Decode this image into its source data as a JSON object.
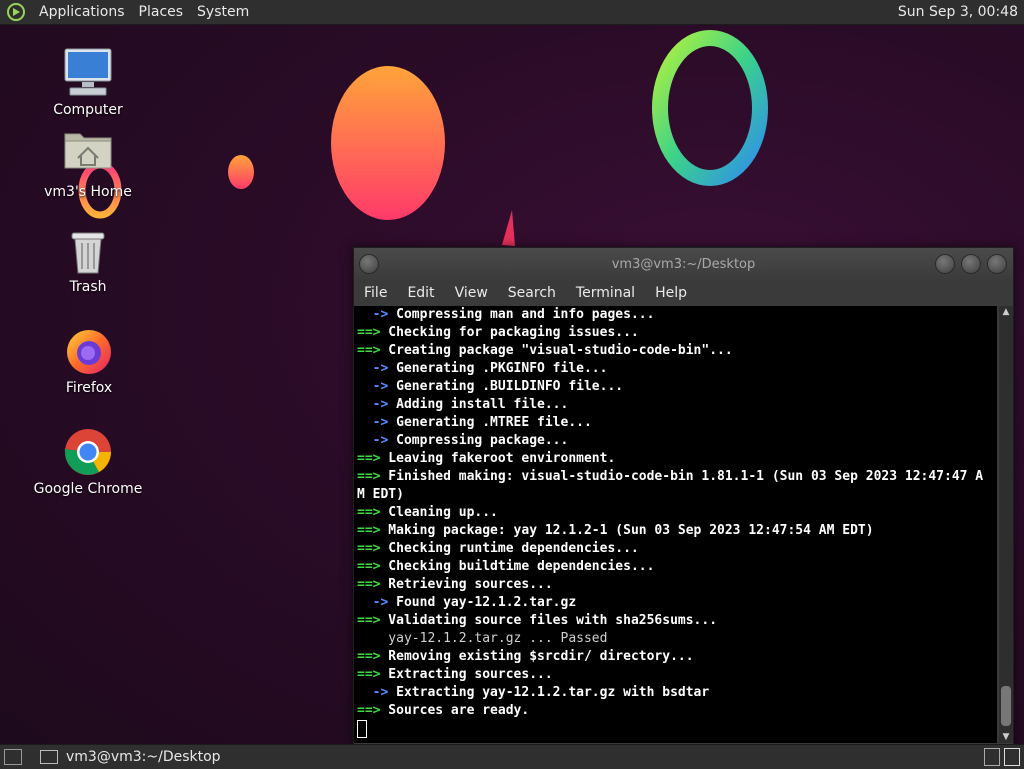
{
  "top_panel": {
    "menus": [
      "Applications",
      "Places",
      "System"
    ],
    "clock": "Sun Sep  3, 00:48"
  },
  "desktop": {
    "icons": [
      {
        "label": "Computer",
        "icon": "computer-icon"
      },
      {
        "label": "vm3's Home",
        "icon": "home-folder-icon"
      },
      {
        "label": "Trash",
        "icon": "trash-icon"
      },
      {
        "label": "Firefox",
        "icon": "firefox-icon"
      },
      {
        "label": "Google Chrome",
        "icon": "chrome-icon"
      }
    ]
  },
  "terminal": {
    "title": "vm3@vm3:~/Desktop",
    "menu": [
      "File",
      "Edit",
      "View",
      "Search",
      "Terminal",
      "Help"
    ],
    "lines": [
      {
        "p": "  ->",
        "t": " Compressing man and info pages..."
      },
      {
        "p": "==>",
        "t": " Checking for packaging issues..."
      },
      {
        "p": "==>",
        "t": " Creating package \"visual-studio-code-bin\"..."
      },
      {
        "p": "  ->",
        "t": " Generating .PKGINFO file..."
      },
      {
        "p": "  ->",
        "t": " Generating .BUILDINFO file..."
      },
      {
        "p": "  ->",
        "t": " Adding install file..."
      },
      {
        "p": "  ->",
        "t": " Generating .MTREE file..."
      },
      {
        "p": "  ->",
        "t": " Compressing package..."
      },
      {
        "p": "==>",
        "t": " Leaving fakeroot environment."
      },
      {
        "p": "==>",
        "t": " Finished making: visual-studio-code-bin 1.81.1-1 (Sun 03 Sep 2023 12:47:47 A"
      },
      {
        "p": "",
        "t": "M EDT)"
      },
      {
        "p": "==>",
        "t": " Cleaning up..."
      },
      {
        "p": "==>",
        "t": " Making package: yay 12.1.2-1 (Sun 03 Sep 2023 12:47:54 AM EDT)"
      },
      {
        "p": "==>",
        "t": " Checking runtime dependencies..."
      },
      {
        "p": "==>",
        "t": " Checking buildtime dependencies..."
      },
      {
        "p": "==>",
        "t": " Retrieving sources..."
      },
      {
        "p": "  ->",
        "t": " Found yay-12.1.2.tar.gz"
      },
      {
        "p": "==>",
        "t": " Validating source files with sha256sums..."
      },
      {
        "p": "",
        "t": "    yay-12.1.2.tar.gz ... Passed",
        "normal": true
      },
      {
        "p": "==>",
        "t": " Removing existing $srcdir/ directory..."
      },
      {
        "p": "==>",
        "t": " Extracting sources..."
      },
      {
        "p": "  ->",
        "t": " Extracting yay-12.1.2.tar.gz with bsdtar"
      },
      {
        "p": "==>",
        "t": " Sources are ready."
      }
    ]
  },
  "bottom_panel": {
    "task_label": "vm3@vm3:~/Desktop"
  }
}
